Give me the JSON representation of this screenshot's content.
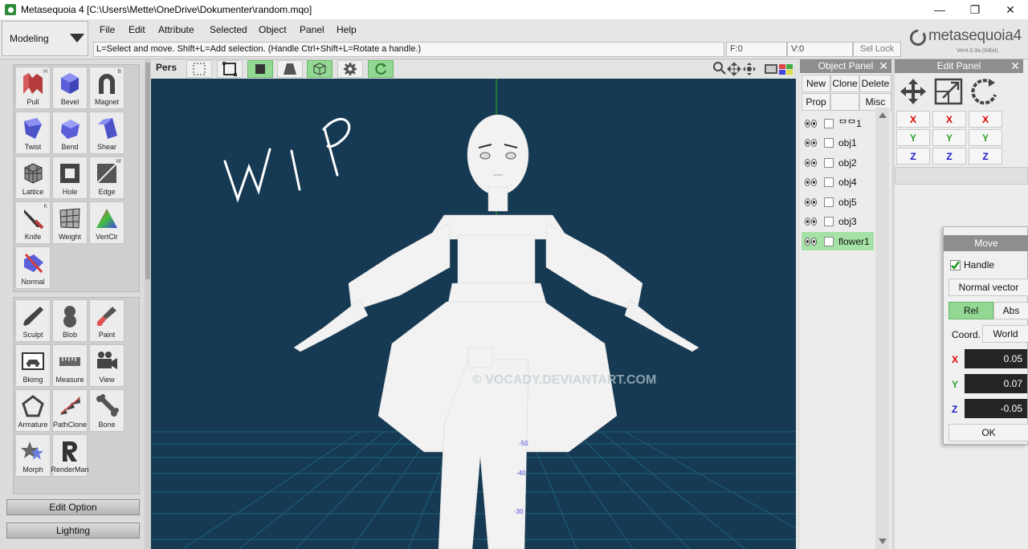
{
  "window": {
    "title": "Metasequoia 4 [C:\\Users\\Mette\\OneDrive\\Dokumenter\\random.mqo]",
    "min": "—",
    "max": "❐",
    "close": "✕"
  },
  "mode_select": {
    "value": "Modeling"
  },
  "menu": [
    "File",
    "Edit",
    "Attribute",
    "Selected",
    "Object",
    "Panel",
    "Help"
  ],
  "status": {
    "hint": "L=Select and move.  Shift+L=Add selection.  (Handle Ctrl+Shift+L=Rotate a handle.)",
    "faces": "F:0",
    "verts": "V:0",
    "sel_lock": "Sel Lock"
  },
  "logo": {
    "text": "metasequoia4",
    "version": "Ver4.6.9a (64bit)"
  },
  "tools_group1": [
    {
      "label": "Pull",
      "key": "H",
      "icon": "pull-icon"
    },
    {
      "label": "Bevel",
      "key": "",
      "icon": "bevel-icon"
    },
    {
      "label": "Magnet",
      "key": "B",
      "icon": "magnet-icon"
    },
    {
      "label": "Twist",
      "key": "",
      "icon": "twist-icon"
    },
    {
      "label": "Bend",
      "key": "",
      "icon": "bend-icon"
    },
    {
      "label": "Shear",
      "key": "",
      "icon": "shear-icon"
    },
    {
      "label": "Lattice",
      "key": "",
      "icon": "lattice-icon"
    },
    {
      "label": "Hole",
      "key": "",
      "icon": "hole-icon"
    },
    {
      "label": "Edge",
      "key": "W",
      "icon": "edge-icon"
    },
    {
      "label": "Knife",
      "key": "K",
      "icon": "knife-icon"
    },
    {
      "label": "Weight",
      "key": "",
      "icon": "weight-icon"
    },
    {
      "label": "VertClr",
      "key": "",
      "icon": "vertclr-icon"
    },
    {
      "label": "Normal",
      "key": "",
      "icon": "normal-icon"
    }
  ],
  "tools_group2": [
    {
      "label": "Sculpt",
      "icon": "sculpt-icon"
    },
    {
      "label": "Blob",
      "icon": "blob-icon"
    },
    {
      "label": "Paint",
      "icon": "paint-icon"
    },
    {
      "label": "Bkimg",
      "icon": "bkimg-icon"
    },
    {
      "label": "Measure",
      "icon": "measure-icon"
    },
    {
      "label": "View",
      "icon": "view-icon"
    },
    {
      "label": "Armature",
      "icon": "armature-icon"
    },
    {
      "label": "PathClone",
      "icon": "pathclone-icon"
    },
    {
      "label": "Bone",
      "icon": "bone-icon"
    },
    {
      "label": "Morph",
      "icon": "morph-icon"
    },
    {
      "label": "RenderMan",
      "icon": "renderman-icon"
    }
  ],
  "side_buttons": {
    "edit_option": "Edit Option",
    "lighting": "Lighting"
  },
  "view_toolbar": {
    "projection": "Pers"
  },
  "viewport": {
    "wip_text": "WIP",
    "watermark": "© VOCADY.DEVIANTART.COM",
    "scale_labels": [
      "-50",
      "-40",
      "-30"
    ]
  },
  "object_panel": {
    "title": "Object Panel",
    "buttons": {
      "new": "New",
      "clone": "Clone",
      "delete": "Delete",
      "prop": "Prop",
      "misc": "Misc"
    },
    "objects": [
      {
        "name": "ᄆᄆ1",
        "selected": false
      },
      {
        "name": "obj1",
        "selected": false
      },
      {
        "name": "obj2",
        "selected": false
      },
      {
        "name": "obj4",
        "selected": false
      },
      {
        "name": "obj5",
        "selected": false
      },
      {
        "name": "obj3",
        "selected": false
      },
      {
        "name": "flower1",
        "selected": true
      }
    ]
  },
  "edit_panel": {
    "title": "Edit Panel",
    "axes": [
      "X",
      "Y",
      "Z"
    ],
    "axis_colors": {
      "X": "#e00000",
      "Y": "#2aa02a",
      "Z": "#1a1ac8"
    }
  },
  "move_panel": {
    "title": "Move",
    "handle_label": "Handle",
    "normal_vector": "Normal vector",
    "rel": "Rel",
    "abs": "Abs",
    "coord_label": "Coord.",
    "coord_value": "World",
    "x_label": "X",
    "x": "0.05",
    "y_label": "Y",
    "y": "0.07",
    "z_label": "Z",
    "z": "-0.05",
    "ok": "OK"
  }
}
